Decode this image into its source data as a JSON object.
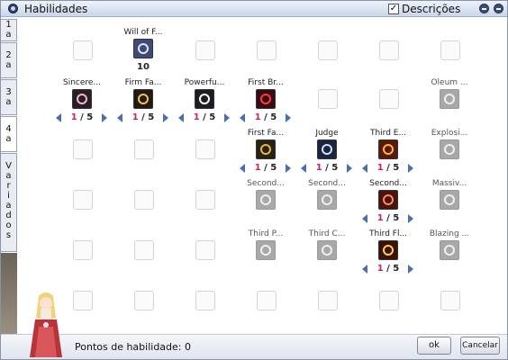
{
  "window": {
    "title": "Habilidades",
    "descriptions_label": "Descrições",
    "descriptions_checked": true
  },
  "tabs": [
    {
      "label": [
        "1",
        "a"
      ]
    },
    {
      "label": [
        "2",
        "a"
      ]
    },
    {
      "label": [
        "3",
        "a"
      ]
    },
    {
      "label": [
        "4",
        "a"
      ]
    },
    {
      "label": [
        "V",
        "a",
        "r",
        "i",
        "a",
        "d",
        "o",
        "s"
      ]
    }
  ],
  "skills": {
    "will_of_faith": {
      "name": "Will of F...",
      "level": "10"
    },
    "sincere": {
      "name": "Sincere...",
      "cur": "1",
      "max": "/ 5"
    },
    "firm_faith": {
      "name": "Firm Fa...",
      "cur": "1",
      "max": "/ 5"
    },
    "powerful": {
      "name": "Powerfu...",
      "cur": "1",
      "max": "/ 5"
    },
    "first_br": {
      "name": "First Br...",
      "cur": "1",
      "max": "/ 5"
    },
    "oleum": {
      "name": "Oleum ..."
    },
    "first_fa": {
      "name": "First Fa...",
      "cur": "1",
      "max": "/ 5"
    },
    "judge": {
      "name": "Judge",
      "cur": "1",
      "max": "/ 5"
    },
    "third_e": {
      "name": "Third E...",
      "cur": "1",
      "max": "/ 5"
    },
    "explosi": {
      "name": "Explosi..."
    },
    "second1": {
      "name": "Second..."
    },
    "second2": {
      "name": "Second..."
    },
    "second3": {
      "name": "Second...",
      "cur": "1",
      "max": "/ 5"
    },
    "massiv": {
      "name": "Massiv..."
    },
    "third_p": {
      "name": "Third P..."
    },
    "third_c": {
      "name": "Third C..."
    },
    "third_fl": {
      "name": "Third Fl...",
      "cur": "1",
      "max": "/ 5"
    },
    "blazing": {
      "name": "Blazing ..."
    }
  },
  "footer": {
    "points_label": "Pontos de habilidade: 0",
    "ok_label": "ok",
    "cancel_label": "Cancelar"
  },
  "colors": {
    "level_current": "#d01e5a",
    "arrow": "#4a6fb0",
    "title_bar": "#c9d6ea"
  }
}
